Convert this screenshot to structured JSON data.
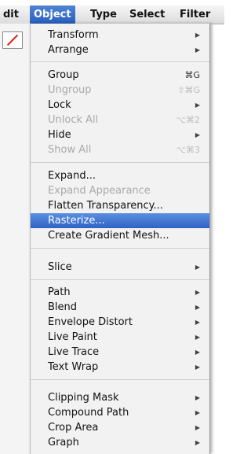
{
  "menubar": {
    "items": [
      {
        "label": "dit"
      },
      {
        "label": "Object"
      },
      {
        "label": "Type"
      },
      {
        "label": "Select"
      },
      {
        "label": "Filter"
      }
    ]
  },
  "menu": {
    "items": [
      {
        "label": "Transform",
        "shortcut": "",
        "submenu": true,
        "disabled": false,
        "highlighted": false
      },
      {
        "label": "Arrange",
        "shortcut": "",
        "submenu": true,
        "disabled": false,
        "highlighted": false
      },
      {
        "label": "Group",
        "shortcut": "⌘G",
        "submenu": false,
        "disabled": false,
        "highlighted": false
      },
      {
        "label": "Ungroup",
        "shortcut": "⇧⌘G",
        "submenu": false,
        "disabled": true,
        "highlighted": false
      },
      {
        "label": "Lock",
        "shortcut": "",
        "submenu": true,
        "disabled": false,
        "highlighted": false
      },
      {
        "label": "Unlock All",
        "shortcut": "⌥⌘2",
        "submenu": false,
        "disabled": true,
        "highlighted": false
      },
      {
        "label": "Hide",
        "shortcut": "",
        "submenu": true,
        "disabled": false,
        "highlighted": false
      },
      {
        "label": "Show All",
        "shortcut": "⌥⌘3",
        "submenu": false,
        "disabled": true,
        "highlighted": false
      },
      {
        "label": "Expand...",
        "shortcut": "",
        "submenu": false,
        "disabled": false,
        "highlighted": false
      },
      {
        "label": "Expand Appearance",
        "shortcut": "",
        "submenu": false,
        "disabled": true,
        "highlighted": false
      },
      {
        "label": "Flatten Transparency...",
        "shortcut": "",
        "submenu": false,
        "disabled": false,
        "highlighted": false
      },
      {
        "label": "Rasterize...",
        "shortcut": "",
        "submenu": false,
        "disabled": false,
        "highlighted": true
      },
      {
        "label": "Create Gradient Mesh...",
        "shortcut": "",
        "submenu": false,
        "disabled": false,
        "highlighted": false
      },
      {
        "label": "Slice",
        "shortcut": "",
        "submenu": true,
        "disabled": false,
        "highlighted": false
      },
      {
        "label": "Path",
        "shortcut": "",
        "submenu": true,
        "disabled": false,
        "highlighted": false
      },
      {
        "label": "Blend",
        "shortcut": "",
        "submenu": true,
        "disabled": false,
        "highlighted": false
      },
      {
        "label": "Envelope Distort",
        "shortcut": "",
        "submenu": true,
        "disabled": false,
        "highlighted": false
      },
      {
        "label": "Live Paint",
        "shortcut": "",
        "submenu": true,
        "disabled": false,
        "highlighted": false
      },
      {
        "label": "Live Trace",
        "shortcut": "",
        "submenu": true,
        "disabled": false,
        "highlighted": false
      },
      {
        "label": "Text Wrap",
        "shortcut": "",
        "submenu": true,
        "disabled": false,
        "highlighted": false
      },
      {
        "label": "Clipping Mask",
        "shortcut": "",
        "submenu": true,
        "disabled": false,
        "highlighted": false
      },
      {
        "label": "Compound Path",
        "shortcut": "",
        "submenu": true,
        "disabled": false,
        "highlighted": false
      },
      {
        "label": "Crop Area",
        "shortcut": "",
        "submenu": true,
        "disabled": false,
        "highlighted": false
      },
      {
        "label": "Graph",
        "shortcut": "",
        "submenu": true,
        "disabled": false,
        "highlighted": false
      }
    ]
  }
}
